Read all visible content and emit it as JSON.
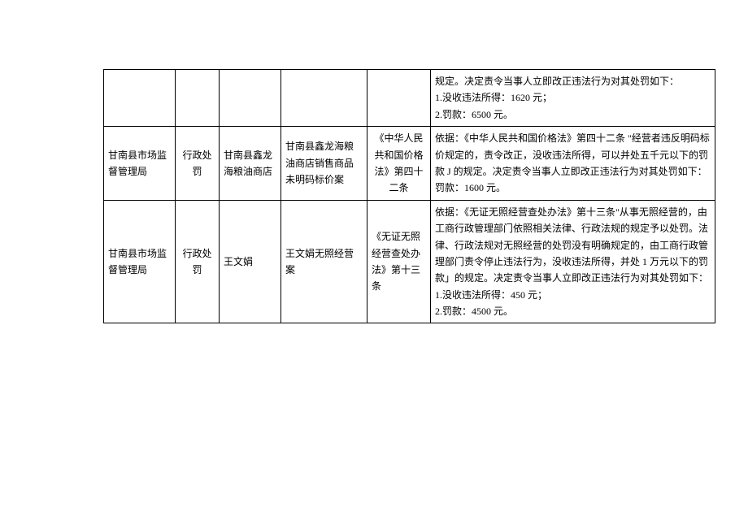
{
  "rows": [
    {
      "agency": "",
      "type": "",
      "party": "",
      "case": "",
      "law": "",
      "detail": "规定。决定责令当事人立即改正违法行为对其处罚如下：\n1.没收违法所得：1620 元；\n2.罚款：6500 元。"
    },
    {
      "agency": "甘南县市场监督管理局",
      "type": "行政处罚",
      "party": "甘南县鑫龙海粮油商店",
      "case": "甘南县鑫龙海粮油商店销售商品未明码标价案",
      "law": "《中华人民共和国价格法》第四十二条",
      "detail": "依据：《中华人民共和国价格法》第四十二条 \"经营者违反明码标价规定的，责令改正，没收违法所得，可以并处五千元以下的罚款 J 的规定。决定责令当事人立即改正违法行为对其处罚如下：罚款：1600 元。"
    },
    {
      "agency": "甘南县市场监督管理局",
      "type": "行政处罚",
      "party": "王文娟",
      "case": "王文娟无照经营案",
      "law": "《无证无照经营查处办法》第十三条",
      "detail": "依据：《无证无照经营查处办法》第十三条\"从事无照经营的，由工商行政管理部门依照相关法律、行政法规的规定予以处罚。法律、行政法规对无照经营的处罚没有明确规定的，由工商行政管理部门责令停止违法行为，没收违法所得，并处 1 万元以下的罚款」的规定。决定责令当事人立即改正违法行为对其处罚如下：\n1.没收违法所得：450 元；\n2.罚款：4500 元。"
    }
  ]
}
